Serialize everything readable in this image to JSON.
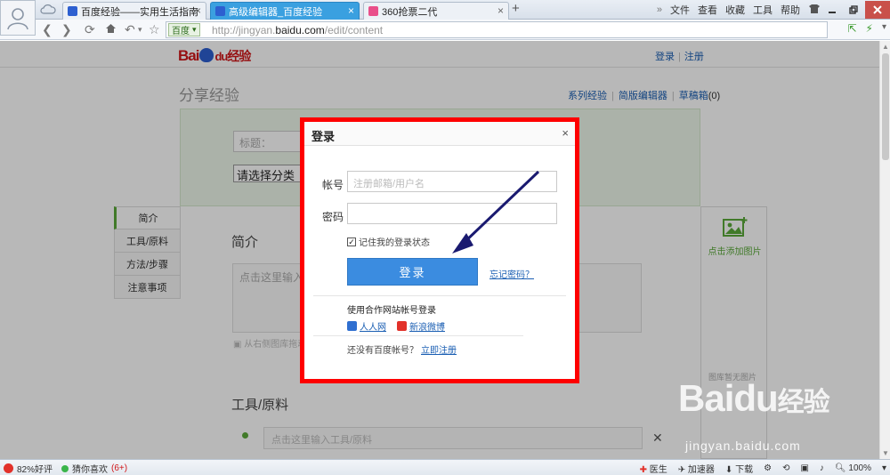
{
  "browser": {
    "tabs": [
      {
        "label": "百度经验——实用生活指南",
        "favicon_color": "#2d5fd0"
      },
      {
        "label": "高级编辑器_百度经验",
        "favicon_color": "#2d5fd0"
      },
      {
        "label": "360抢票二代",
        "favicon_color": "#e94f8a"
      }
    ],
    "menu": [
      "文件",
      "查看",
      "收藏",
      "工具",
      "帮助"
    ],
    "search_engine": "百度",
    "url_prefix": "http://jingyan.",
    "url_domain": "baidu.com",
    "url_path": "/edit/content"
  },
  "site": {
    "logo_text": "Bai",
    "logo_du": "du",
    "logo_suffix": "经验",
    "login": "登录",
    "register": "注册"
  },
  "editor": {
    "heading": "分享经验",
    "links": [
      "系列经验",
      "简版编辑器",
      "草稿箱"
    ],
    "draft_count": "(0)",
    "title_placeholder": "标题：",
    "category": "请选择分类",
    "side_tabs": [
      "简介",
      "工具/原料",
      "方法/步骤",
      "注意事项"
    ],
    "intro_heading": "简介",
    "intro_placeholder": "点击这里输入",
    "image_hint": "从右侧图库拖动",
    "tools_heading": "工具/原料",
    "tools_placeholder": "点击这里输入工具/原料",
    "add_image": "点击添加图片",
    "no_images": "图库暂无图片"
  },
  "modal": {
    "title": "登录",
    "account_label": "帐号",
    "account_placeholder": "注册邮箱/用户名",
    "password_label": "密码",
    "remember": "记住我的登录状态",
    "login_button": "登录",
    "forgot": "忘记密码？",
    "partner_title": "使用合作网站帐号登录",
    "partners": [
      {
        "label": "人人网",
        "color": "#2f6fd0"
      },
      {
        "label": "新浪微博",
        "color": "#e2312a"
      }
    ],
    "no_account": "还没有百度帐号？",
    "register_now": "立即注册",
    "highlight_color": "#ff0000"
  },
  "watermark": {
    "brand": "Baidu",
    "suffix": "经验",
    "url": "jingyan.baidu.com"
  },
  "status": {
    "rating": "82%好评",
    "guess": "猜你喜欢",
    "guess_count": "(6+)",
    "doctor": "医生",
    "accelerator": "加速器",
    "download": "下载",
    "zoom": "100%"
  }
}
